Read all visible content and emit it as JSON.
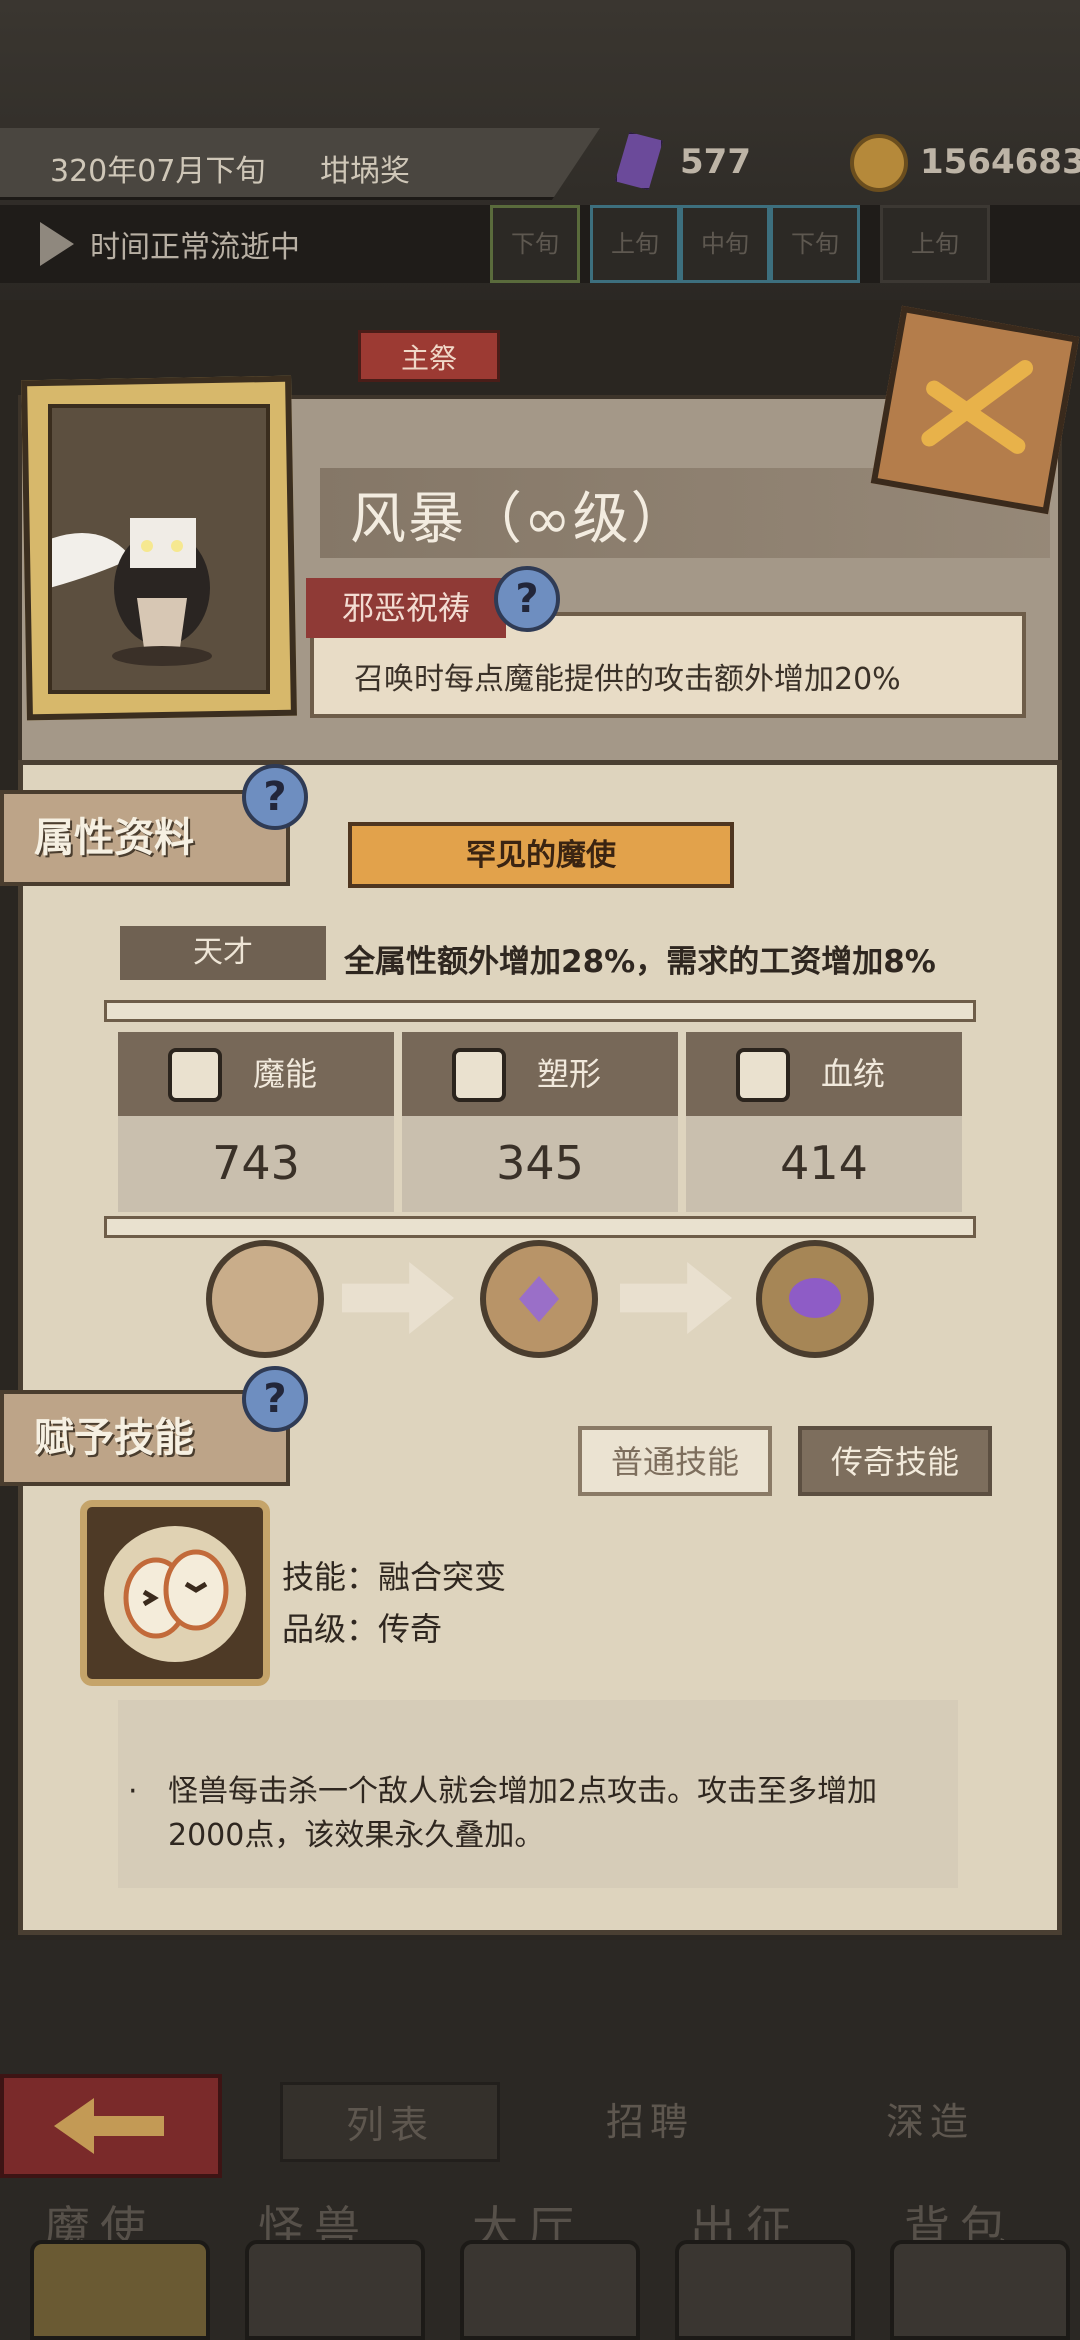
{
  "hud": {
    "date": "320年07月下旬",
    "season": "坩埚奖",
    "gem_count": "577",
    "coin_count": "1564683",
    "time_status": "时间正常流逝中",
    "segments": [
      "下旬",
      "上旬",
      "中旬",
      "下旬",
      "上旬"
    ]
  },
  "header": {
    "tag": "主祭",
    "name": "风暴（∞级）",
    "trait_label": "邪恶祝祷",
    "trait_desc": "召唤时每点魔能提供的攻击额外增加20%"
  },
  "attributes": {
    "section_label": "属性资料",
    "rarity": "罕见的魔使",
    "talent_label": "天才",
    "talent_desc": "全属性额外增加28%，需求的工资增加8%",
    "stats": [
      {
        "label": "魔能",
        "value": "743"
      },
      {
        "label": "塑形",
        "value": "345"
      },
      {
        "label": "血统",
        "value": "414"
      }
    ]
  },
  "skills": {
    "section_label": "赋予技能",
    "tab_normal": "普通技能",
    "tab_legend": "传奇技能",
    "skill_name": "技能：融合突变",
    "skill_grade": "品级：传奇",
    "bullet": "·",
    "description": "怪兽每击杀一个敌人就会增加2点攻击。攻击至多增加2000点，该效果永久叠加。"
  },
  "nav": {
    "tabs": [
      "列表",
      "招聘",
      "深造"
    ],
    "bottom": [
      "魔使",
      "怪兽",
      "大厅",
      "出征",
      "背包"
    ]
  }
}
